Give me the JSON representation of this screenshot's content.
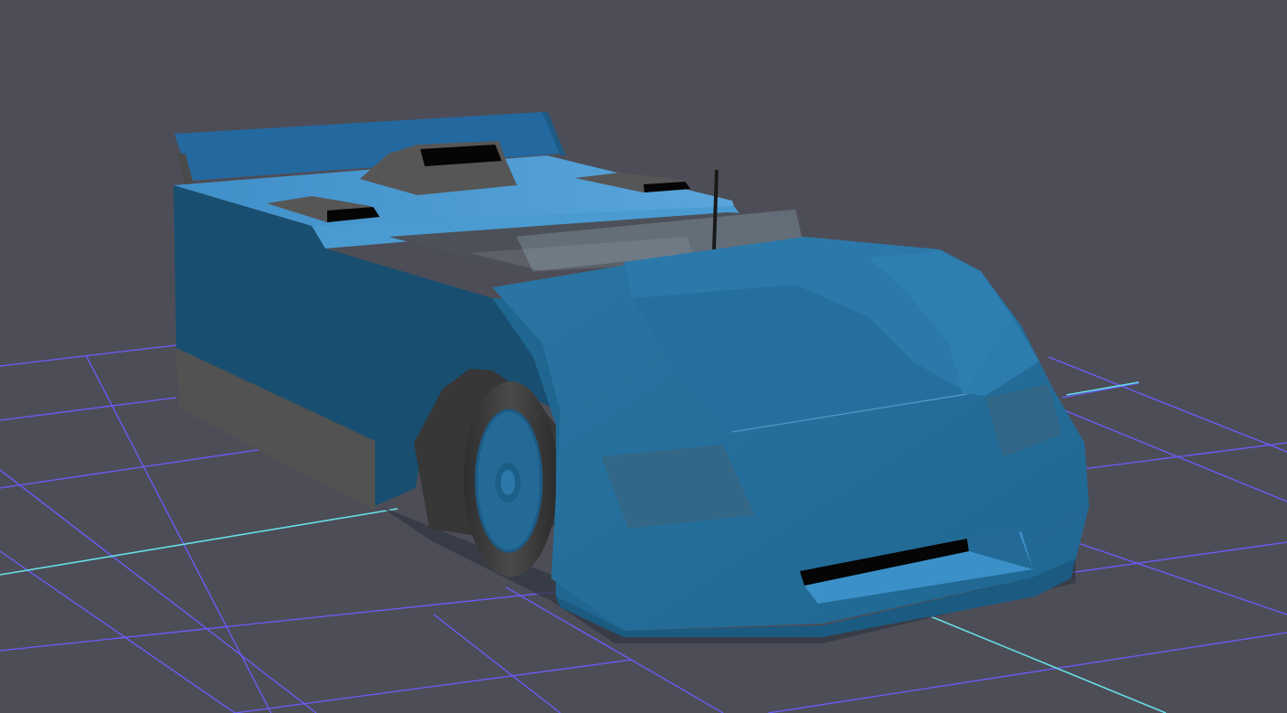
{
  "scene": {
    "subject": "race-car-3d-model",
    "background_color": "#4d4d57",
    "grid_color": "#6a5cff",
    "axis_color": "#66e0e6",
    "body_color": "#236a96",
    "body_shadow_color": "#184f70",
    "body_highlight_color": "#3f8fc4",
    "rubber_color": "#3c3c3c",
    "trim_color": "#525252"
  }
}
